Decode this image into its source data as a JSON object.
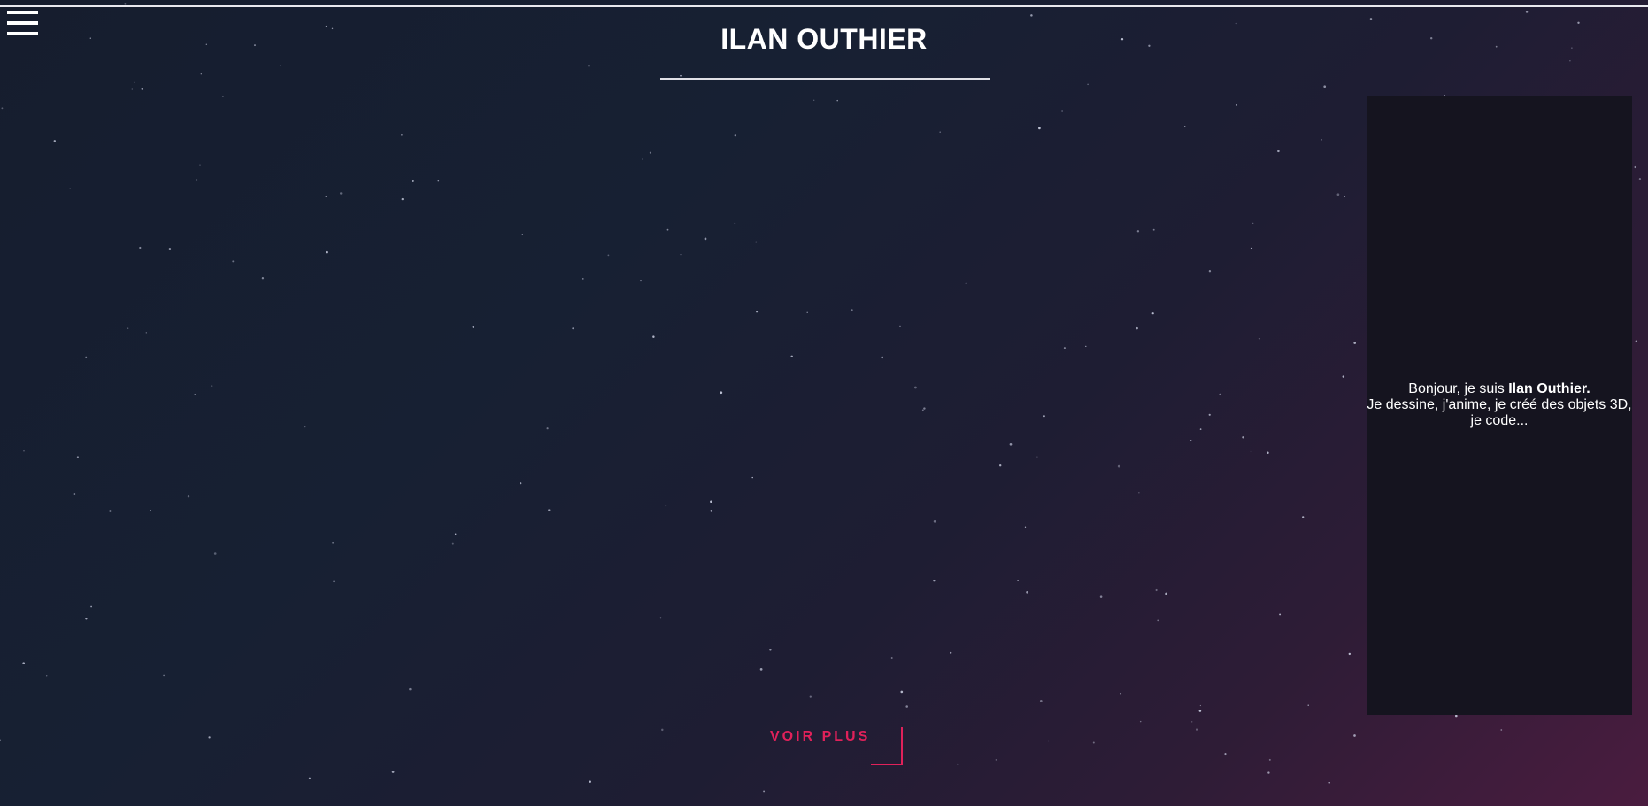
{
  "header": {
    "menu_icon": "hamburger-menu-icon",
    "title": "ILAN OUTHIER"
  },
  "intro": {
    "greeting": "Bonjour, je suis ",
    "name": "Ilan Outhier.",
    "description": "Je dessine, j'anime, je créé des objets 3D, je code..."
  },
  "cta": {
    "label": "VOIR PLUS"
  },
  "colors": {
    "accent": "#e0215a",
    "background_start": "#161d2e",
    "background_end": "#4a1c3f",
    "panel": "#15141f",
    "text": "#ffffff"
  }
}
